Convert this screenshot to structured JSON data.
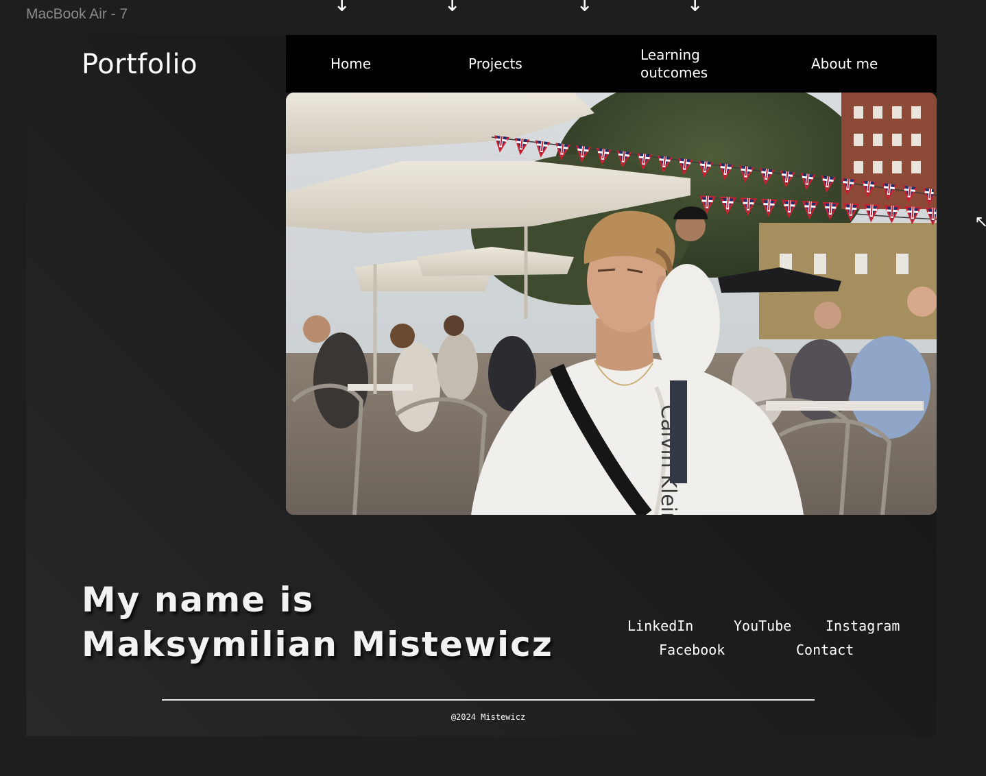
{
  "canvas": {
    "frame_label": "MacBook Air - 7"
  },
  "indicators": {
    "arrow_glyph": "↓",
    "cursor_glyph": "↖"
  },
  "site": {
    "brand": "Portfolio",
    "nav": {
      "home": "Home",
      "projects": "Projects",
      "learning_outcomes": "Learning outcomes",
      "about_me": "About me"
    },
    "hero_image": {
      "alt": "Photo of a young man in a white Calvin Klein t-shirt sitting at an outdoor café with umbrellas and Union Jack bunting"
    },
    "headline": {
      "line1": "My name is",
      "line2": "Maksymilian Mistewicz"
    },
    "social": {
      "linkedin": "LinkedIn",
      "youtube": "YouTube",
      "instagram": "Instagram",
      "facebook": "Facebook",
      "contact": "Contact"
    },
    "footer": {
      "copyright": "@2024 Mistewicz"
    }
  },
  "colors": {
    "canvas_bg": "#1e1e1e",
    "nav_bg": "#000000",
    "text": "#ffffff",
    "frame_label": "#8a8a8a",
    "divider": "#e6e6e6"
  }
}
